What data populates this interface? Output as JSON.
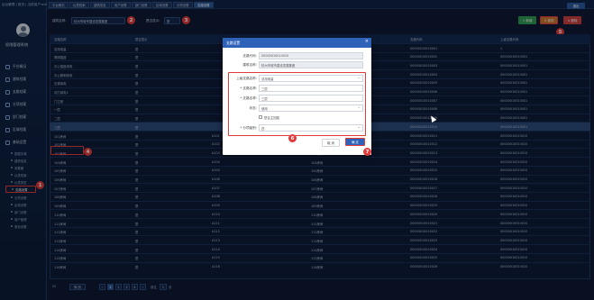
{
  "brand": {
    "top_text": "后台管理 | 首页 | 当前用户:admin",
    "system_name": "权限管理系统"
  },
  "sidebar": {
    "items": [
      {
        "label": "平台概况"
      },
      {
        "label": "建筑档案"
      },
      {
        "label": "支路档案"
      },
      {
        "label": "分项档案"
      },
      {
        "label": "部门档案"
      },
      {
        "label": "区域档案"
      },
      {
        "label": "基础设置"
      }
    ],
    "subitems": [
      {
        "label": "数据字典"
      },
      {
        "label": "建筑信息"
      },
      {
        "label": "采集器"
      },
      {
        "label": "仪表档案"
      },
      {
        "label": "仪表类型"
      },
      {
        "label": "支路设置",
        "active": true
      },
      {
        "label": "分项设置"
      },
      {
        "label": "区域设置"
      },
      {
        "label": "部门设置"
      },
      {
        "label": "用户管理"
      },
      {
        "label": "角色设置"
      }
    ]
  },
  "top_tabs": [
    "平台概况",
    "仪表档案",
    "建筑信息",
    "用户设置",
    "部门设置",
    "区域设置",
    "分项设置",
    "支路设置"
  ],
  "top_button": "退出",
  "filter": {
    "building_label": "建筑名称:",
    "building_value": "杭州市城市建设发展集团",
    "show_label": "是否显示:",
    "show_value": "是",
    "add_label": "+ 新增",
    "edit_label": "✎ 修改",
    "delete_label": "× 删除"
  },
  "table": {
    "headers": [
      "支路名称",
      "是否显示",
      "",
      "",
      "",
      "支路代码",
      "上级支路代码"
    ],
    "rows": [
      {
        "name": "总用电量",
        "show": "是",
        "c3": "",
        "c4": "",
        "code": "00000010010001",
        "parent": "1"
      },
      {
        "name": "照明插座",
        "show": "是",
        "c3": "",
        "c4": "",
        "code": "00000010010002",
        "parent": "00000010010001"
      },
      {
        "name": "办公插座用电",
        "show": "是",
        "c3": "",
        "c4": "",
        "code": "00000010010003",
        "parent": "00000010010001"
      },
      {
        "name": "办公照明用电",
        "show": "是",
        "c3": "",
        "c4": "",
        "code": "00000010010004",
        "parent": "00000010010001"
      },
      {
        "name": "空调用电",
        "show": "是",
        "c3": "",
        "c4": "",
        "code": "00000010010005",
        "parent": "00000010010001"
      },
      {
        "name": "动力用电1",
        "show": "是",
        "c3": "",
        "c4": "",
        "code": "00000010010006",
        "parent": "00000010010001"
      },
      {
        "name": "门卫室",
        "show": "是",
        "c3": "",
        "c4": "",
        "code": "00000010010007",
        "parent": "00000010010001"
      },
      {
        "name": "一层",
        "show": "是",
        "c3": "",
        "c4": "",
        "code": "00000010010008",
        "parent": "00000010010001"
      },
      {
        "name": "二层",
        "show": "是",
        "c3": "",
        "c4": "",
        "code": "00000010010009",
        "parent": "00000010010001"
      },
      {
        "name": "三层",
        "show": "是",
        "c3": "",
        "c4": "",
        "code": "00000010010010",
        "parent": "00000010010001",
        "selected": true
      },
      {
        "name": "101房间",
        "show": "是",
        "c3": "A101",
        "c4": "101房间",
        "code": "00000010010011",
        "parent": "00000010010010"
      },
      {
        "name": "102房间",
        "show": "是",
        "c3": "A102",
        "c4": "102房间",
        "code": "00000010010012",
        "parent": "00000010010010"
      },
      {
        "name": "103房间",
        "show": "是",
        "c3": "A103",
        "c4": "103房间",
        "code": "00000010010013",
        "parent": "00000010010010"
      },
      {
        "name": "104房间",
        "show": "是",
        "c3": "A104",
        "c4": "104房间",
        "code": "00000010010014",
        "parent": "00000010010010"
      },
      {
        "name": "105房间",
        "show": "是",
        "c3": "A105",
        "c4": "105房间",
        "code": "00000010010015",
        "parent": "00000010010010"
      },
      {
        "name": "106房间",
        "show": "是",
        "c3": "A106",
        "c4": "106房间",
        "code": "00000010010016",
        "parent": "00000010010010"
      },
      {
        "name": "107房间",
        "show": "是",
        "c3": "A107",
        "c4": "107房间",
        "code": "00000010010017",
        "parent": "00000010010010"
      },
      {
        "name": "108房间",
        "show": "是",
        "c3": "A108",
        "c4": "108房间",
        "code": "00000010010018",
        "parent": "00000010010010"
      },
      {
        "name": "109房间",
        "show": "是",
        "c3": "A109",
        "c4": "109房间",
        "code": "00000010010019",
        "parent": "00000010010010"
      },
      {
        "name": "110房间",
        "show": "是",
        "c3": "A110",
        "c4": "110房间",
        "code": "00000010010020",
        "parent": "00000010010010"
      },
      {
        "name": "111房间",
        "show": "是",
        "c3": "A111",
        "c4": "111房间",
        "code": "00000010010021",
        "parent": "00000010010010"
      },
      {
        "name": "112房间",
        "show": "是",
        "c3": "A112",
        "c4": "112房间",
        "code": "00000010010022",
        "parent": "00000010010010"
      },
      {
        "name": "113房间",
        "show": "是",
        "c3": "A113",
        "c4": "113房间",
        "code": "00000010010023",
        "parent": "00000010010010"
      },
      {
        "name": "114房间",
        "show": "是",
        "c3": "A114",
        "c4": "114房间",
        "code": "00000010010024",
        "parent": "00000010010010"
      },
      {
        "name": "115房间",
        "show": "是",
        "c3": "A115",
        "c4": "115房间",
        "code": "00000010010025",
        "parent": "00000010010010"
      },
      {
        "name": "116房间",
        "show": "是",
        "c3": "A116",
        "c4": "116房间",
        "code": "00000010010026",
        "parent": "00000010010010"
      }
    ]
  },
  "footer": {
    "page_size": "25",
    "page_size_unit": "条/页",
    "pages": [
      "1",
      "2",
      "3",
      "4"
    ],
    "current_page": "1",
    "goto_label": "前往",
    "page_unit": "页"
  },
  "dialog": {
    "title": "支路设置",
    "fields": [
      {
        "label": "支路代码:",
        "value": "00000010010010"
      },
      {
        "label": "建筑名称:",
        "value": "杭州市城市建设发展集团"
      },
      {
        "label": "上级支路名称:",
        "value": "总用电量"
      },
      {
        "label": "* 支路名称:",
        "value": "三层"
      },
      {
        "label": "* 支路名称:",
        "value": "三层"
      },
      {
        "label": "状态:",
        "value": "使用"
      },
      {
        "label": "",
        "value": "是否主回路"
      },
      {
        "label": "* 分项级别:",
        "value": "四"
      }
    ],
    "cancel_label": "取 消",
    "confirm_label": "确 定"
  },
  "markers": [
    "1",
    "2",
    "3",
    "4",
    "5",
    "6",
    "7"
  ]
}
